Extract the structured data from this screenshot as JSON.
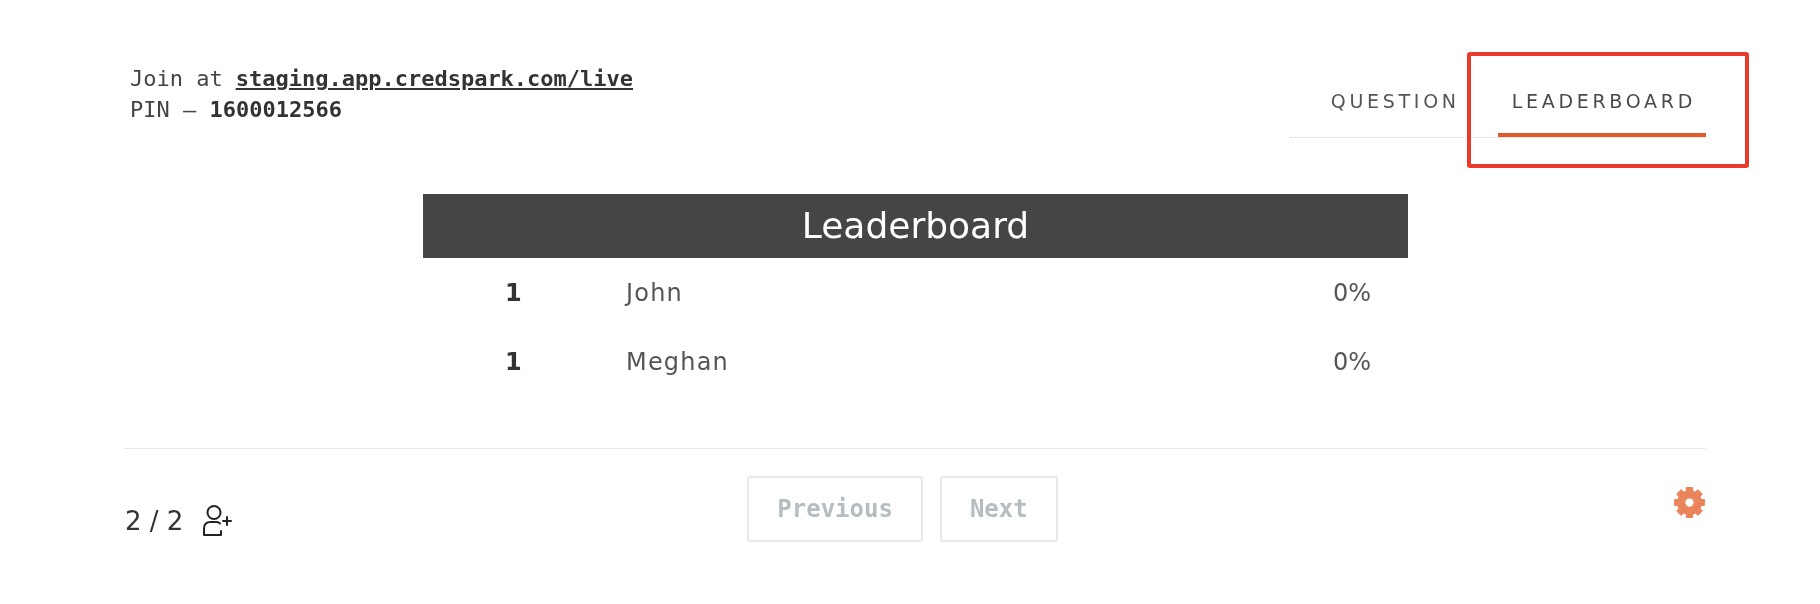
{
  "join": {
    "label": "Join at",
    "link": "staging.app.credspark.com/live"
  },
  "pin": "PIN – **1600012566**",
  "tabs": [
    {
      "label": "QUESTION",
      "selected": false,
      "highlighted": false
    },
    {
      "label": "LEADERBOARD",
      "selected": true,
      "highlighted": true
    }
  ],
  "leaderboard": {
    "title": "Leaderboard",
    "rows": [
      {
        "rank": "1",
        "name": "John",
        "score": "0%"
      },
      {
        "rank": "1",
        "name": "Meghan",
        "score": "0%"
      }
    ]
  },
  "footer": {
    "participants": "2 / 2",
    "buttons": [
      {
        "label": "Previous",
        "disabled": true
      },
      {
        "label": "Next",
        "disabled": true
      }
    ]
  }
}
